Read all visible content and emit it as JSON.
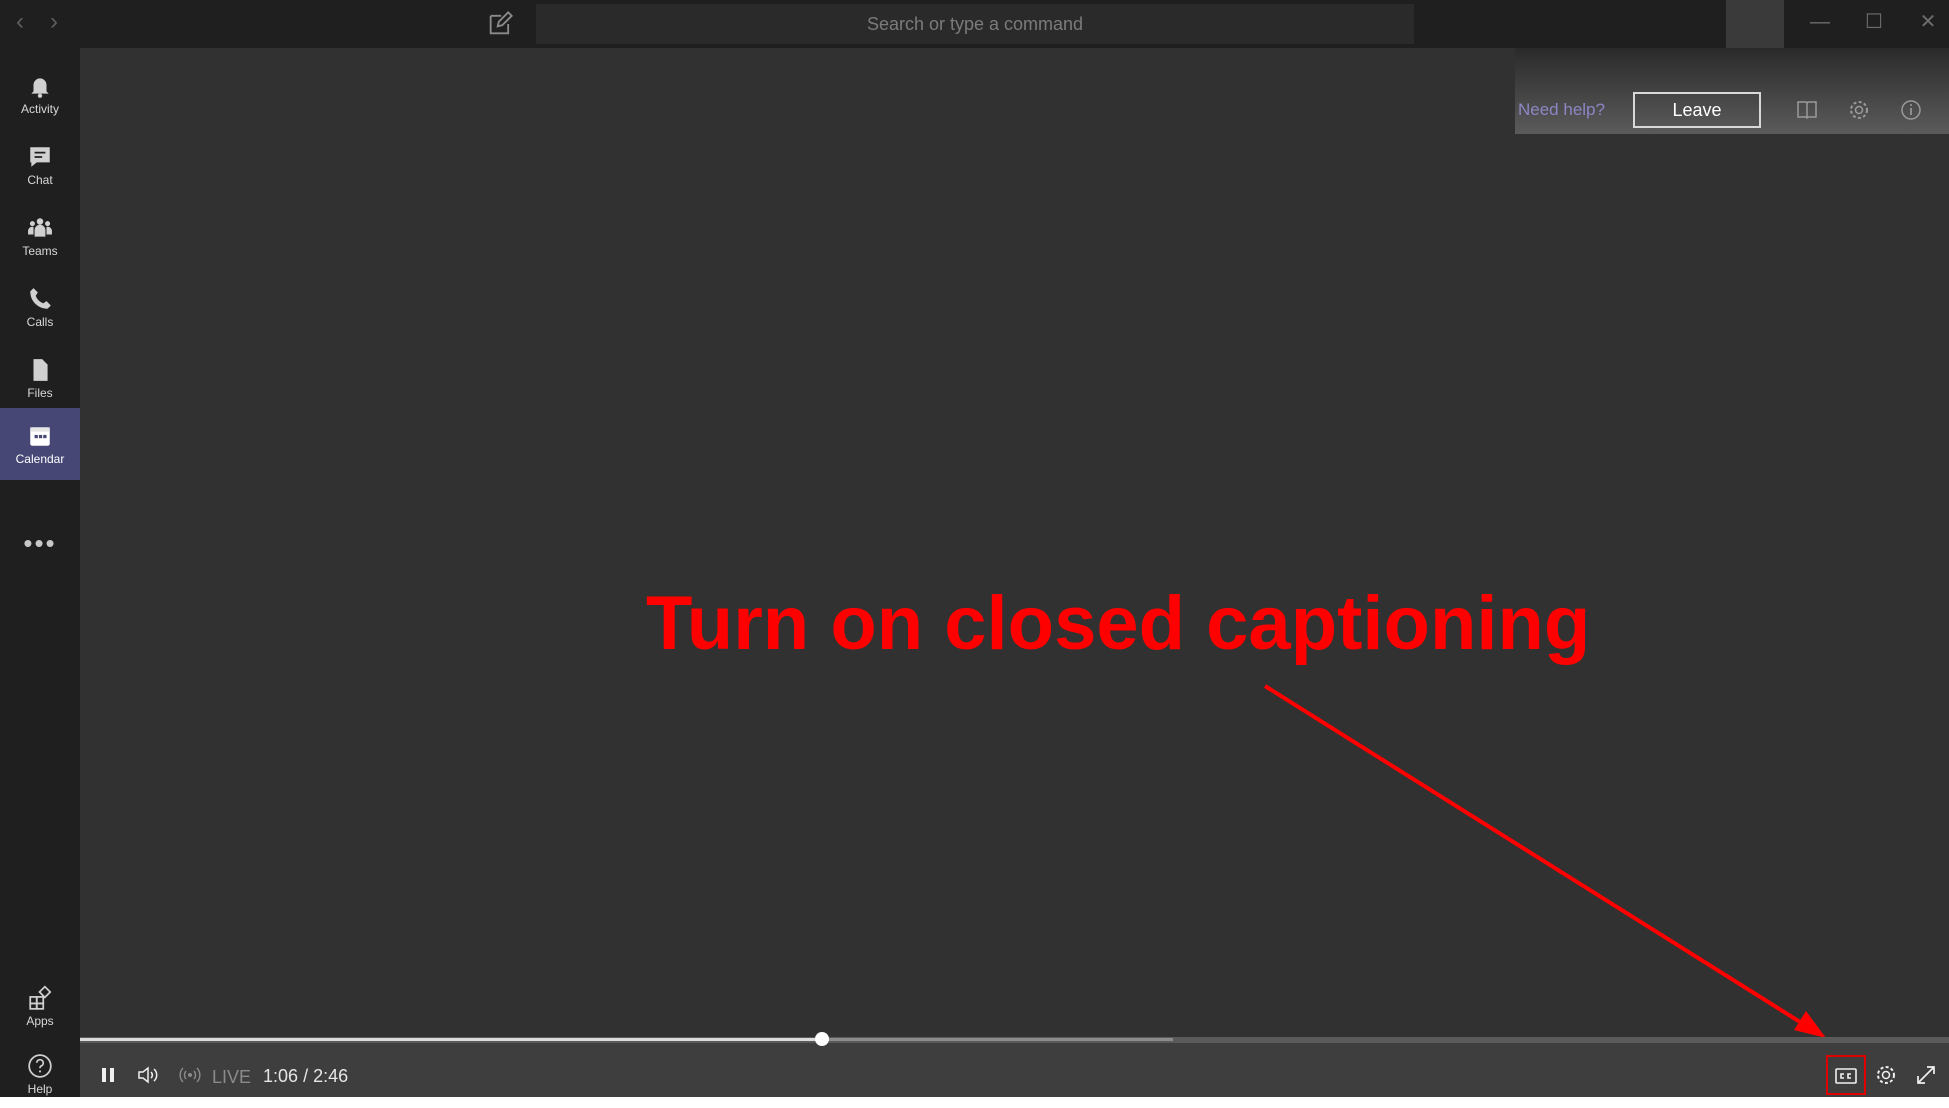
{
  "titlebar": {
    "back_icon": "chevron-left-icon",
    "forward_icon": "chevron-right-icon",
    "compose_icon": "compose-icon",
    "search_placeholder": "Search or type a command",
    "minimize_glyph": "—",
    "maximize_glyph": "☐",
    "close_glyph": "✕"
  },
  "rail": {
    "items": [
      {
        "label": "Activity",
        "icon": "bell-icon"
      },
      {
        "label": "Chat",
        "icon": "chat-icon"
      },
      {
        "label": "Teams",
        "icon": "teams-icon"
      },
      {
        "label": "Calls",
        "icon": "phone-icon"
      },
      {
        "label": "Files",
        "icon": "file-icon"
      },
      {
        "label": "Calendar",
        "icon": "calendar-icon",
        "active": true
      }
    ],
    "more_label": "•••",
    "bottom": [
      {
        "label": "Apps",
        "icon": "apps-icon"
      },
      {
        "label": "Help",
        "icon": "help-icon"
      }
    ]
  },
  "meeting": {
    "need_help_label": "Need help?",
    "leave_label": "Leave",
    "annotation": "Turn on closed captioning"
  },
  "player": {
    "live_label": "LIVE",
    "current_time": "1:06",
    "separator": "/",
    "duration": "2:46",
    "progress_fraction": 0.397,
    "buffered_fraction": 0.585
  },
  "colors": {
    "annotation": "#ff0000",
    "rail_active": "#464775",
    "need_help_link": "#8c86c4"
  }
}
